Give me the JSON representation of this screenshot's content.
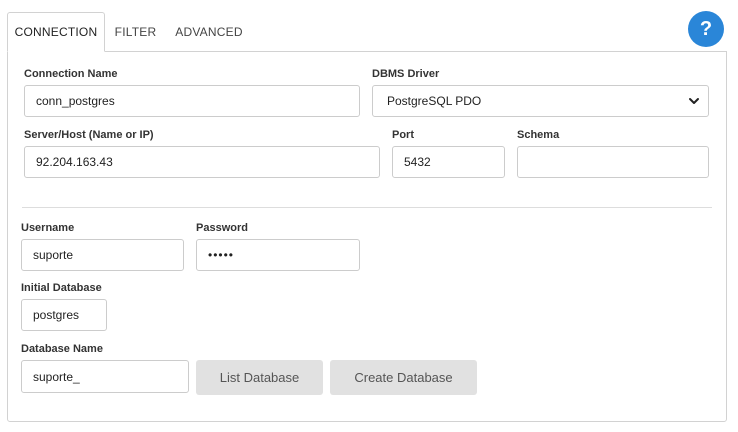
{
  "tabs": {
    "connection": "CONNECTION",
    "filter": "FILTER",
    "advanced": "ADVANCED"
  },
  "help": {
    "icon": "question-circle-icon",
    "glyph": "?",
    "color": "#2a86d8"
  },
  "form": {
    "connection_name": {
      "label": "Connection Name",
      "value": "conn_postgres"
    },
    "dbms_driver": {
      "label": "DBMS Driver",
      "value": "PostgreSQL PDO"
    },
    "server_host": {
      "label": "Server/Host (Name or IP)",
      "value": "92.204.163.43"
    },
    "port": {
      "label": "Port",
      "value": "5432"
    },
    "schema": {
      "label": "Schema",
      "value": ""
    },
    "username": {
      "label": "Username",
      "value": "suporte"
    },
    "password": {
      "label": "Password",
      "value": "•••••"
    },
    "initial_database": {
      "label": "Initial Database",
      "value": "postgres"
    },
    "database_name": {
      "label": "Database Name",
      "value": "suporte_"
    }
  },
  "buttons": {
    "list_database": "List Database",
    "create_database": "Create Database"
  }
}
